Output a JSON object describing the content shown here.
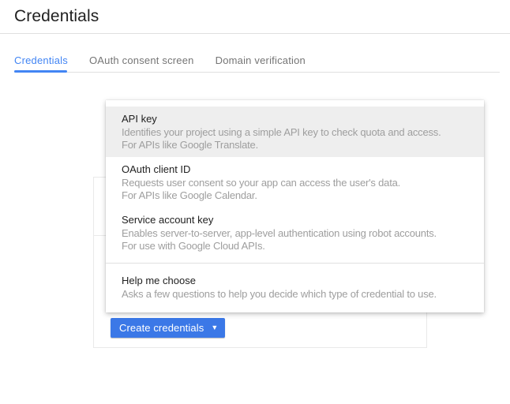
{
  "page": {
    "title": "Credentials"
  },
  "tabs": [
    {
      "label": "Credentials",
      "active": true
    },
    {
      "label": "OAuth consent screen",
      "active": false
    },
    {
      "label": "Domain verification",
      "active": false
    }
  ],
  "create_button": {
    "label": "Create credentials",
    "caret_icon": "▼"
  },
  "menu": {
    "items": [
      {
        "title": "API key",
        "desc_line1": "Identifies your project using a simple API key to check quota and access.",
        "desc_line2": "For APIs like Google Translate.",
        "highlighted": true
      },
      {
        "title": "OAuth client ID",
        "desc_line1": "Requests user consent so your app can access the user's data.",
        "desc_line2": "For APIs like Google Calendar.",
        "highlighted": false
      },
      {
        "title": "Service account key",
        "desc_line1": "Enables server-to-server, app-level authentication using robot accounts.",
        "desc_line2": "For use with Google Cloud APIs.",
        "highlighted": false
      },
      {
        "title": "Help me choose",
        "desc_line1": "Asks a few questions to help you decide which type of credential to use.",
        "highlighted": false
      }
    ]
  },
  "colors": {
    "accent_blue": "#4285f4",
    "button_blue": "#3b78e7",
    "highlight_gray": "#eeeeee",
    "divider_gray": "#e0e0e0",
    "desc_gray": "#9e9e9e",
    "tab_inactive_gray": "#757575"
  }
}
